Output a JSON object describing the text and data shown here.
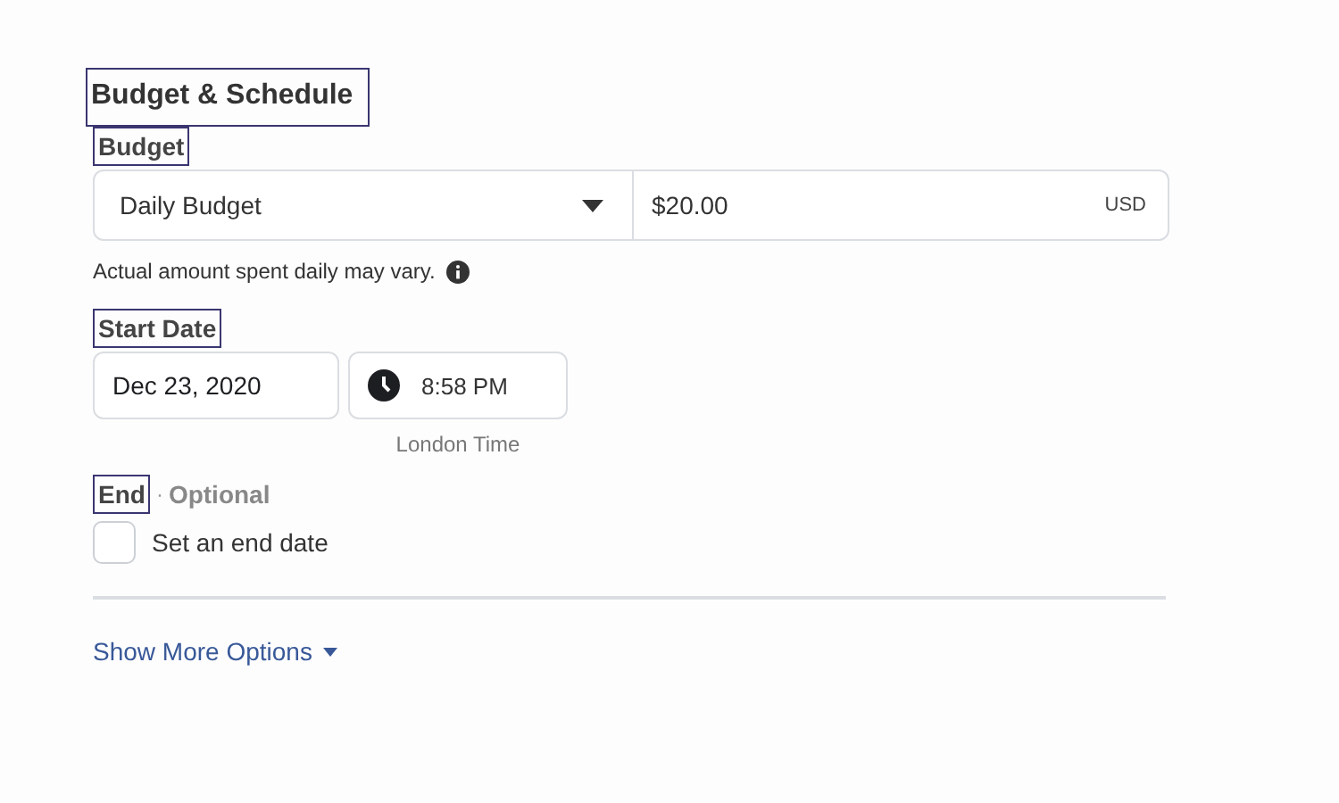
{
  "section_title": "Budget & Schedule",
  "budget": {
    "label": "Budget",
    "type": "Daily Budget",
    "amount": "$20.00",
    "currency": "USD",
    "hint": "Actual amount spent daily may vary."
  },
  "start_date": {
    "label": "Start Date",
    "date": "Dec 23, 2020",
    "time": "8:58 PM",
    "timezone": "London Time"
  },
  "end": {
    "label": "End",
    "separator": "·",
    "optional": "Optional",
    "checkbox": {
      "label": "Set an end date",
      "checked": false
    }
  },
  "more_options": "Show More Options"
}
